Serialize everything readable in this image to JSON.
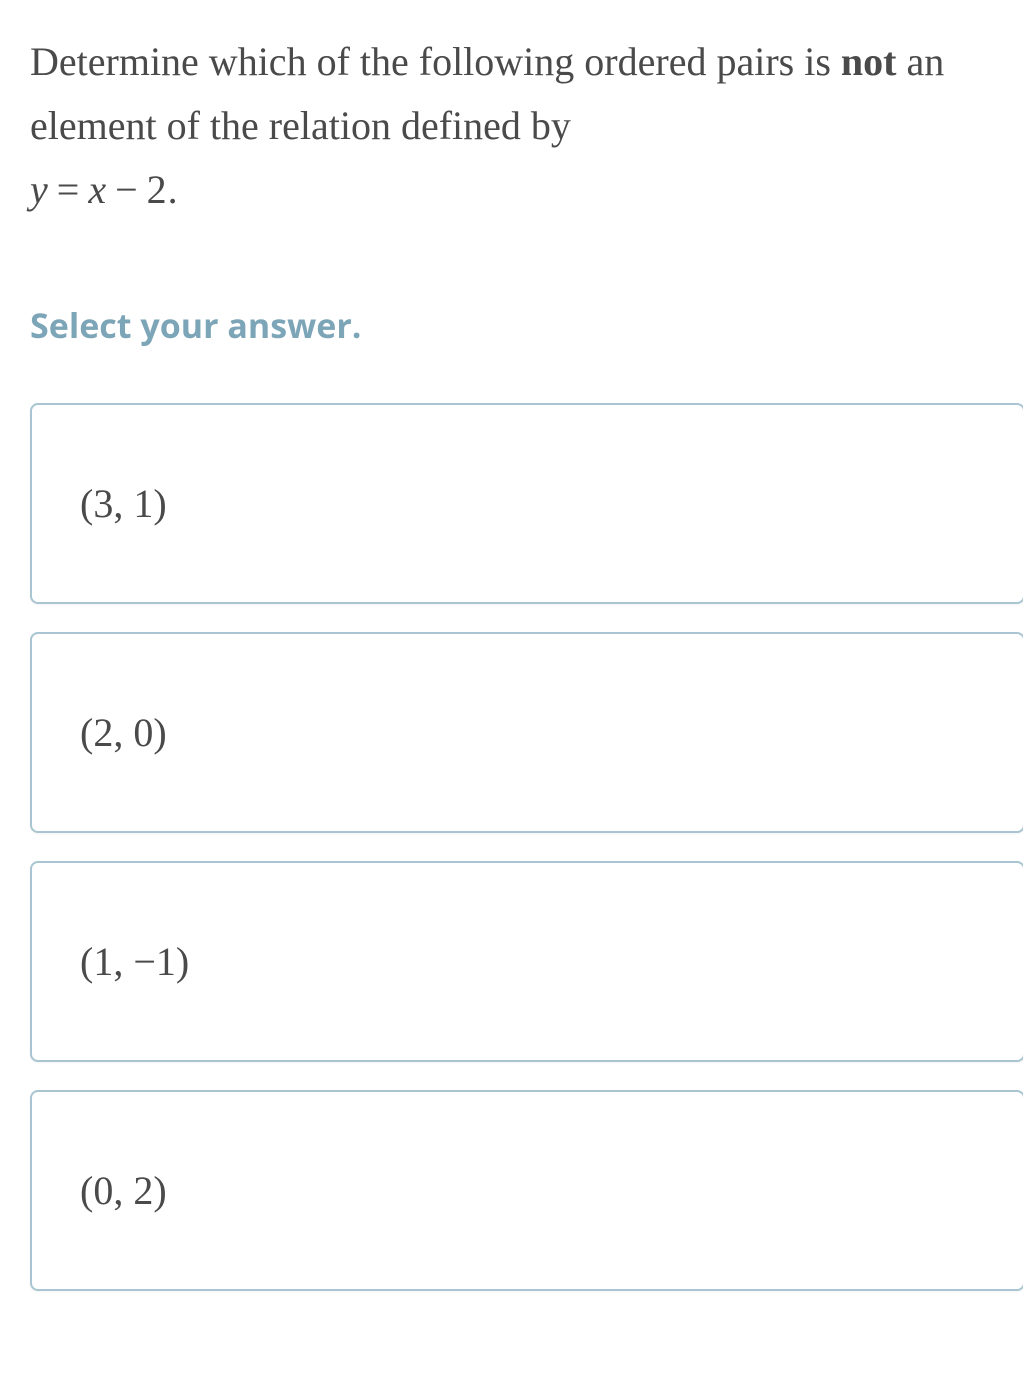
{
  "question": {
    "part1": "Determine which of the following ordered pairs is ",
    "bold": "not",
    "part2": " an element of the relation defined by ",
    "equation_y": "y",
    "equation_eq": "=",
    "equation_x": "x",
    "equation_minus": "−",
    "equation_two": "2",
    "equation_period": "."
  },
  "prompt": "Select your answer.",
  "options": [
    "(3, 1)",
    "(2, 0)",
    "(1, −1)",
    "(0, 2)"
  ]
}
